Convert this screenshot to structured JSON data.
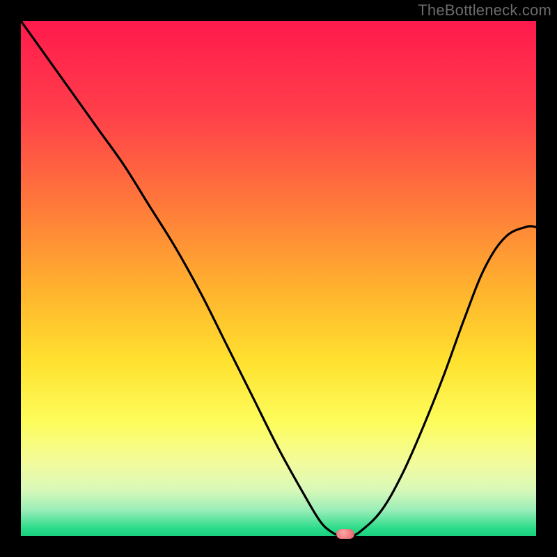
{
  "watermark": "TheBottleneck.com",
  "chart_data": {
    "type": "line",
    "title": "",
    "xlabel": "",
    "ylabel": "",
    "xlim": [
      0,
      100
    ],
    "ylim": [
      0,
      100
    ],
    "grid": false,
    "gradient_background": {
      "stops": [
        {
          "offset": 0.0,
          "color": "#ff1a4d"
        },
        {
          "offset": 0.18,
          "color": "#ff3f4a"
        },
        {
          "offset": 0.36,
          "color": "#ff7a3a"
        },
        {
          "offset": 0.52,
          "color": "#ffb22e"
        },
        {
          "offset": 0.66,
          "color": "#ffe12f"
        },
        {
          "offset": 0.78,
          "color": "#fdfd5c"
        },
        {
          "offset": 0.86,
          "color": "#f2fb9e"
        },
        {
          "offset": 0.91,
          "color": "#d9f9b8"
        },
        {
          "offset": 0.95,
          "color": "#99edb8"
        },
        {
          "offset": 0.985,
          "color": "#2bdc8a"
        },
        {
          "offset": 1.0,
          "color": "#17d17e"
        }
      ]
    },
    "series": [
      {
        "name": "bottleneck-curve",
        "x": [
          0,
          5,
          10,
          15,
          20,
          25,
          30,
          35,
          40,
          45,
          50,
          55,
          58,
          60,
          62,
          64,
          66,
          70,
          74,
          78,
          82,
          86,
          90,
          94,
          98,
          100
        ],
        "y": [
          100,
          93,
          86,
          79,
          72,
          64,
          56,
          47,
          37,
          27,
          17,
          8,
          3,
          1,
          0,
          0,
          1,
          5,
          12,
          21,
          31,
          42,
          52,
          58,
          60,
          60
        ]
      }
    ],
    "marker": {
      "x": 63,
      "y": 0
    }
  }
}
